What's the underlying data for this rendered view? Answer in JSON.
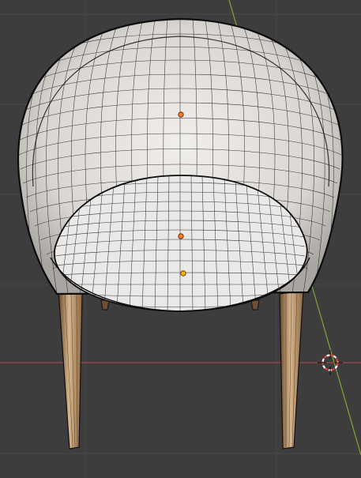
{
  "viewport": {
    "colors": {
      "background": "#3d3d3d",
      "grid_line": "#474747",
      "x_axis": "#a8444f",
      "y_axis": "#7da833",
      "mesh_fill": "#e9e7e5",
      "mesh_shade": "#bdb9b4",
      "wireframe": "#111111",
      "leg_light": "#d3b28b",
      "leg_dark": "#7a5a38",
      "origin_selected": "#ff7a22",
      "origin_active": "#ffb000",
      "cursor_red": "#e0413c",
      "cursor_white": "#ffffff"
    },
    "object_name": "chair-mesh",
    "origin_points": [
      "backrest-origin",
      "seat-origin",
      "base-origin"
    ],
    "cursor": "3d-cursor-icon"
  }
}
